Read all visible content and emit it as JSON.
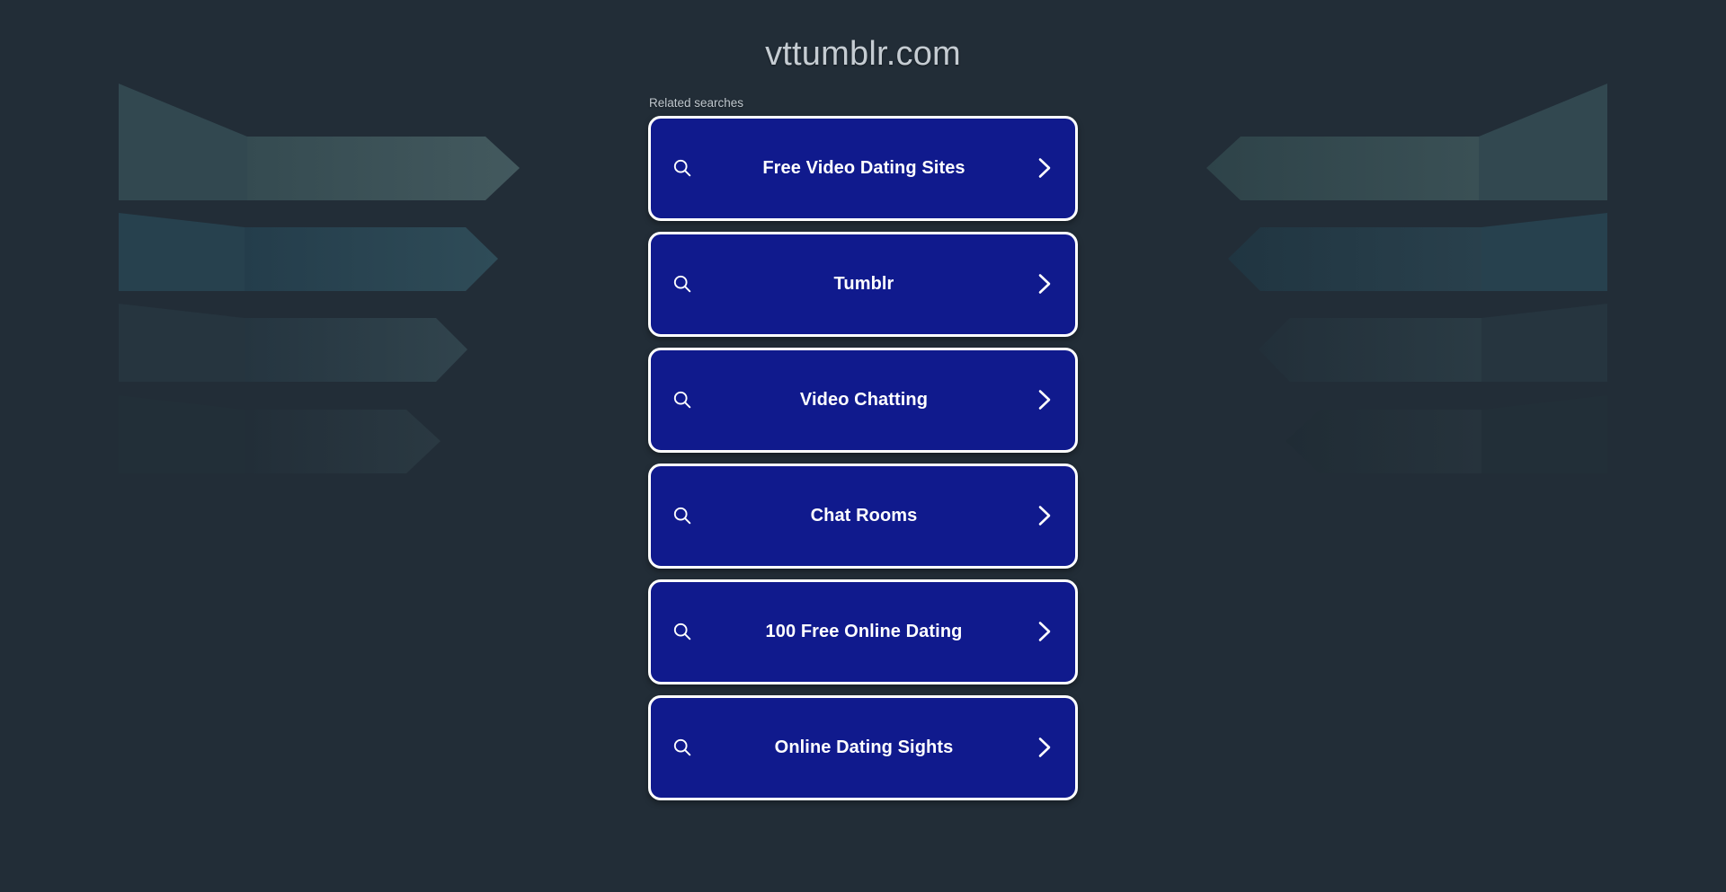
{
  "page": {
    "title": "vttumblr.com",
    "background_color": "#222d37",
    "card_color": "#101a8d",
    "card_border_color": "#ffffff",
    "title_color": "#c5ccd2"
  },
  "related": {
    "label": "Related searches",
    "items": [
      {
        "label": "Free Video Dating Sites",
        "search_icon": "search-icon",
        "chevron_icon": "chevron-right-icon"
      },
      {
        "label": "Tumblr",
        "search_icon": "search-icon",
        "chevron_icon": "chevron-right-icon"
      },
      {
        "label": "Video Chatting",
        "search_icon": "search-icon",
        "chevron_icon": "chevron-right-icon"
      },
      {
        "label": "Chat Rooms",
        "search_icon": "search-icon",
        "chevron_icon": "chevron-right-icon"
      },
      {
        "label": "100 Free Online Dating",
        "search_icon": "search-icon",
        "chevron_icon": "chevron-right-icon"
      },
      {
        "label": "Online Dating Sights",
        "search_icon": "search-icon",
        "chevron_icon": "chevron-right-icon"
      }
    ]
  },
  "decor": {
    "name": "chevron-bands-background",
    "band_colors": [
      "#3d5459",
      "#2a4450",
      "#2c3f48",
      "#26343d"
    ],
    "band_shadow_colors": [
      "#30464b",
      "#22394482",
      "#263640",
      "#222f38"
    ]
  }
}
